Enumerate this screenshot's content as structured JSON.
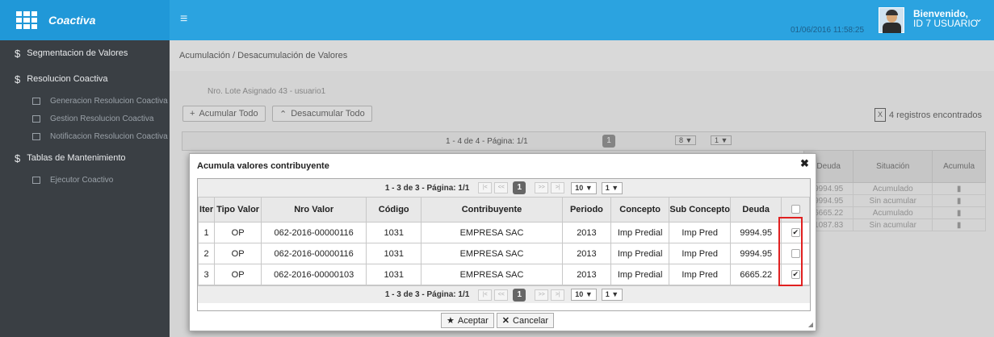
{
  "app": {
    "name": "Coactiva"
  },
  "header": {
    "datetime": "01/06/2016 11:58:25",
    "welcome_line1": "Bienvenido,",
    "welcome_line2": "ID 7 USUARIO"
  },
  "sidebar": {
    "sections": [
      {
        "label": "Segmentacion de Valores",
        "items": []
      },
      {
        "label": "Resolucion Coactiva",
        "items": [
          "Generacion Resolucion Coactiva",
          "Gestion Resolucion Coactiva",
          "Notificacion Resolucion Coactiva"
        ]
      },
      {
        "label": "Tablas de Mantenimiento",
        "items": [
          "Ejecutor Coactivo"
        ]
      }
    ]
  },
  "main": {
    "breadcrumb": "Acumulación / Desacumulación de Valores",
    "lote": "Nro. Lote Asignado  43 - usuario1",
    "btn_acumular": "Acumular Todo",
    "btn_desacumular": "Desacumular Todo",
    "registros": "4 registros encontrados",
    "pager_text": "1 - 4 de 4 - Página: 1/1",
    "pager_page": "1",
    "pager_size": "8",
    "pager_pg": "1",
    "bg_headers": [
      "Deuda",
      "Situación",
      "Acumula"
    ],
    "bg_rows": [
      [
        "9994.95",
        "Acumulado"
      ],
      [
        "9994.95",
        "Sin acumular"
      ],
      [
        "6665.22",
        "Acumulado"
      ],
      [
        "1087.83",
        "Sin acumular"
      ]
    ]
  },
  "dialog": {
    "title": "Acumula valores contribuyente",
    "pager_text": "1 - 3 de 3 - Página: 1/1",
    "pager_page": "1",
    "page_size": "10",
    "page_select": "1",
    "columns": [
      "Iter",
      "Tipo Valor",
      "Nro Valor",
      "Código",
      "Contribuyente",
      "Periodo",
      "Concepto",
      "Sub Concepto",
      "Deuda",
      ""
    ],
    "rows": [
      {
        "iter": "1",
        "tipo": "OP",
        "nro": "062-2016-00000116",
        "codigo": "1031",
        "contribuyente": "EMPRESA SAC",
        "periodo": "2013",
        "concepto": "Imp Predial",
        "sub": "Imp Pred",
        "deuda": "9994.95",
        "checked": true
      },
      {
        "iter": "2",
        "tipo": "OP",
        "nro": "062-2016-00000116",
        "codigo": "1031",
        "contribuyente": "EMPRESA SAC",
        "periodo": "2013",
        "concepto": "Imp Predial",
        "sub": "Imp Pred",
        "deuda": "9994.95",
        "checked": false
      },
      {
        "iter": "3",
        "tipo": "OP",
        "nro": "062-2016-00000103",
        "codigo": "1031",
        "contribuyente": "EMPRESA SAC",
        "periodo": "2013",
        "concepto": "Imp Predial",
        "sub": "Imp Pred",
        "deuda": "6665.22",
        "checked": true
      }
    ],
    "btn_aceptar": "Aceptar",
    "btn_cancelar": "Cancelar"
  }
}
